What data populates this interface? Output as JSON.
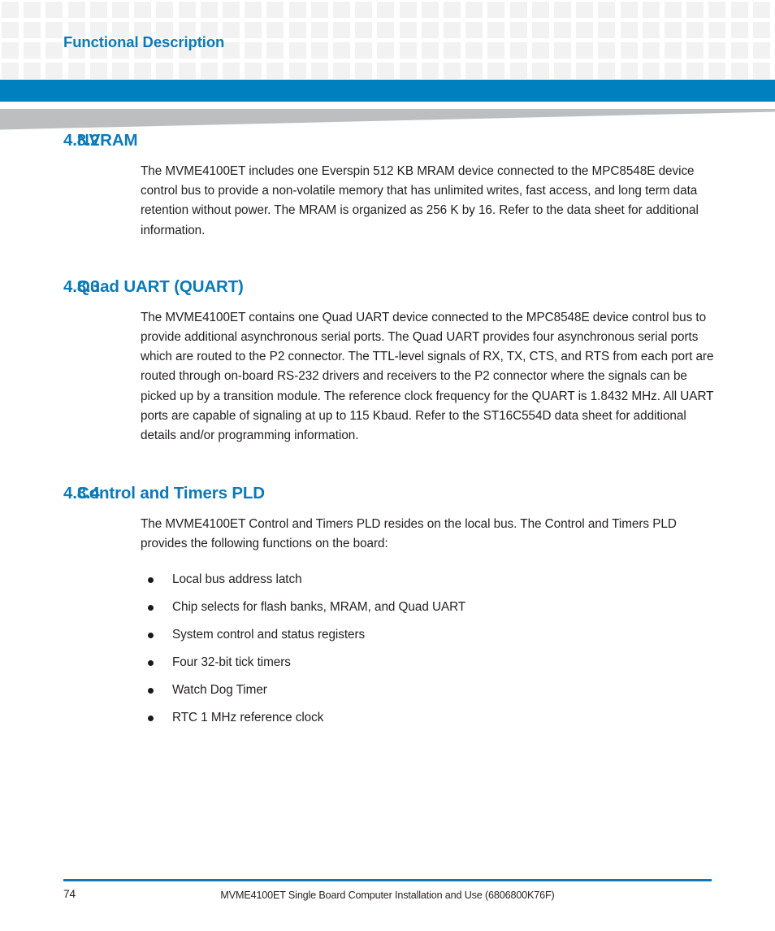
{
  "header": {
    "running_head": "Functional Description",
    "accent_color": "#0c7ab6",
    "bar_color": "#0080bf",
    "wedge_color": "#bcbec0",
    "grid_color": "#f2f2f2"
  },
  "sections": [
    {
      "number": "4.8.2",
      "title": "NVRAM",
      "paragraphs": [
        "The MVME4100ET includes one Everspin 512 KB MRAM device connected to the MPC8548E device control bus to provide a non-volatile memory that has unlimited writes, fast access, and long term data retention without power. The MRAM is organized as 256 K by 16. Refer to the data sheet for additional information."
      ],
      "bullets": []
    },
    {
      "number": "4.8.3",
      "title": "Quad UART (QUART)",
      "paragraphs": [
        "The MVME4100ET contains one Quad UART device connected to the MPC8548E device control bus to provide additional asynchronous serial ports. The Quad UART provides four asynchronous serial ports which are routed to the P2 connector. The TTL-level signals of RX, TX, CTS, and RTS from each port are routed through on-board RS-232 drivers and receivers to the P2 connector where the signals can be picked up by a transition module. The reference clock frequency for the QUART is 1.8432 MHz. All UART ports are capable of signaling at up to 115 Kbaud. Refer to the ST16C554D data sheet for additional details and/or programming information."
      ],
      "bullets": []
    },
    {
      "number": "4.8.4",
      "title": "Control and Timers PLD",
      "paragraphs": [
        "The MVME4100ET Control and Timers PLD resides on the local bus. The Control and Timers PLD provides the following functions on the board:"
      ],
      "bullets": [
        "Local bus address latch",
        "Chip selects for flash banks, MRAM, and Quad UART",
        "System control and status registers",
        "Four 32-bit tick timers",
        "Watch Dog Timer",
        "RTC 1 MHz reference clock"
      ]
    }
  ],
  "footer": {
    "page_number": "74",
    "document_title": "MVME4100ET Single Board Computer Installation and Use (6806800K76F)"
  }
}
